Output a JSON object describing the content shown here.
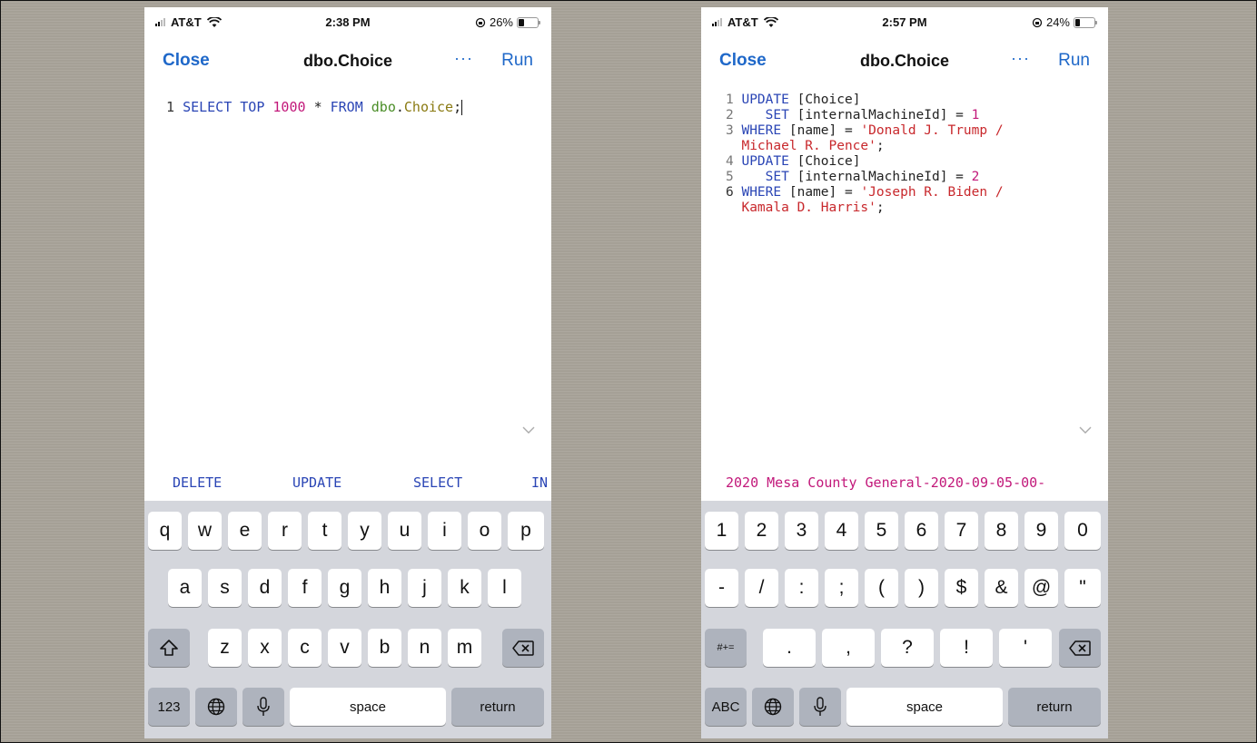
{
  "left_phone": {
    "status": {
      "carrier": "AT&T",
      "time": "2:38 PM",
      "battery": "26%",
      "battery_level": 0.26
    },
    "nav": {
      "close": "Close",
      "title": "dbo.Choice",
      "more": "···",
      "run": "Run"
    },
    "code": {
      "line_number": "1",
      "kw1": "SELECT",
      "kw2": "TOP",
      "number": "1000",
      "star": "*",
      "kw3": "FROM",
      "schema": "dbo",
      "dot": ".",
      "table": "Choice",
      "semicolon": ";"
    },
    "suggestions": [
      "DELETE",
      "UPDATE",
      "SELECT",
      "IN"
    ],
    "keyboard": {
      "row1": [
        "q",
        "w",
        "e",
        "r",
        "t",
        "y",
        "u",
        "i",
        "o",
        "p"
      ],
      "row2": [
        "a",
        "s",
        "d",
        "f",
        "g",
        "h",
        "j",
        "k",
        "l"
      ],
      "row3": [
        "z",
        "x",
        "c",
        "v",
        "b",
        "n",
        "m"
      ],
      "mode": "123",
      "space": "space",
      "return": "return"
    }
  },
  "right_phone": {
    "status": {
      "carrier": "AT&T",
      "time": "2:57 PM",
      "battery": "24%",
      "battery_level": 0.24
    },
    "nav": {
      "close": "Close",
      "title": "dbo.Choice",
      "more": "···",
      "run": "Run"
    },
    "code": {
      "l1": {
        "n": "1",
        "kw": "UPDATE",
        "rest": " [Choice]"
      },
      "l2": {
        "n": "2",
        "kw": "SET",
        "rest": " [internalMachineId] = ",
        "num": "1"
      },
      "l3": {
        "n": "3",
        "kw": "WHERE",
        "rest": " [name] = ",
        "str": "'Donald J. Trump /"
      },
      "l3b": {
        "str": "Michael R. Pence'",
        "end": ";"
      },
      "l4": {
        "n": "4",
        "kw": "UPDATE",
        "rest": " [Choice]"
      },
      "l5": {
        "n": "5",
        "kw": "SET",
        "rest": " [internalMachineId] = ",
        "num": "2"
      },
      "l6": {
        "n": "6",
        "kw": "WHERE",
        "rest": " [name] = ",
        "str": "'Joseph R. Biden /"
      },
      "l6b": {
        "str": "Kamala D. Harris'",
        "end": ";"
      }
    },
    "suggestion": "2020 Mesa County General-2020-09-05-00-",
    "keyboard": {
      "row1": [
        "1",
        "2",
        "3",
        "4",
        "5",
        "6",
        "7",
        "8",
        "9",
        "0"
      ],
      "row2": [
        "-",
        "/",
        ":",
        ";",
        "(",
        ")",
        "$",
        "&",
        "@",
        "\""
      ],
      "row3": [
        ".",
        ",",
        "?",
        "!",
        "'"
      ],
      "symbols": "#+=",
      "mode": "ABC",
      "space": "space",
      "return": "return"
    }
  }
}
